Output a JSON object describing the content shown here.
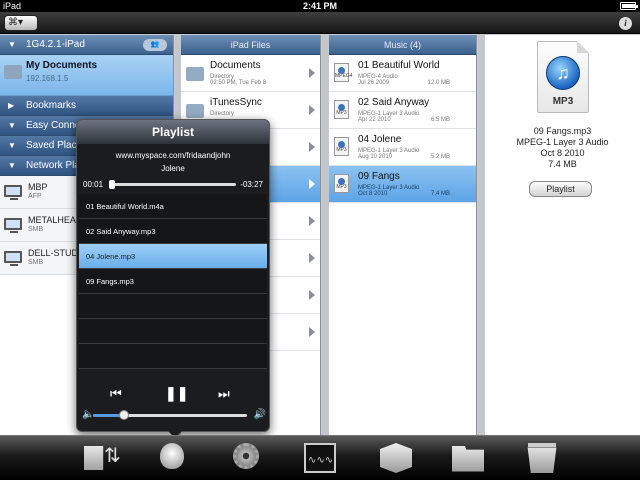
{
  "statusbar": {
    "carrier": "iPad",
    "time": "2:41 PM",
    "battery_level": 0.9
  },
  "toolbar": {
    "menu_glyph": "⌘▾",
    "info_glyph": "i"
  },
  "sidebar": {
    "device_header": "1G4.2.1-iPad",
    "my_documents": {
      "title": "My Documents",
      "subtitle": "192.168.1.5"
    },
    "sections": [
      {
        "label": "Bookmarks"
      },
      {
        "label": "Easy Connect™"
      },
      {
        "label": "Saved Places"
      },
      {
        "label": "Network Places"
      }
    ],
    "devices": [
      {
        "name": "MBP",
        "type": "AFP"
      },
      {
        "name": "METALHEAD",
        "type": "SMB"
      },
      {
        "name": "DELL-STUDIO",
        "type": "SMB"
      }
    ]
  },
  "ipad_files": {
    "header": "iPad Files",
    "rows": [
      {
        "name": "Documents",
        "kind": "Directory",
        "date": "02:50 PM, Tue Feb 8"
      },
      {
        "name": "iTunesSync",
        "kind": "Directory",
        "date": ""
      }
    ]
  },
  "music": {
    "header": "Music (4)",
    "rows": [
      {
        "name": "01 Beautiful World",
        "kind": "MPEG-4 Audio",
        "date": "Jul 26 2009",
        "size": "12.0 MB",
        "icon": "MPEG4"
      },
      {
        "name": "02 Said Anyway",
        "kind": "MPEG-1 Layer 3 Audio",
        "date": "Apr 22 2010",
        "size": "6.5 MB",
        "icon": "MP3"
      },
      {
        "name": "04 Jolene",
        "kind": "MPEG-1 Layer 3 Audio",
        "date": "Aug 10 2010",
        "size": "5.2 MB",
        "icon": "MP3"
      },
      {
        "name": "09 Fangs",
        "kind": "MPEG-1 Layer 3 Audio",
        "date": "Oct 8 2010",
        "size": "7.4 MB",
        "icon": "MP3"
      }
    ]
  },
  "detail": {
    "icon_label": "MP3",
    "icon_glyph": "♫",
    "filename": "09 Fangs.mp3",
    "kind": "MPEG-1 Layer 3 Audio",
    "date": "Oct 8 2010",
    "size": "7.4 MB",
    "button": "Playlist"
  },
  "playlist": {
    "title": "Playlist",
    "source": "www.myspace.com/fridaandjohn",
    "now_playing": "Jolene",
    "elapsed": "00:01",
    "remaining": "-03:27",
    "progress": 0.01,
    "volume": 0.2,
    "items": [
      "01 Beautiful World.m4a",
      "02 Said Anyway.mp3",
      "04 Jolene.mp3",
      "09 Fangs.mp3"
    ],
    "controls": {
      "prev": "⏮",
      "pause": "❚❚",
      "next": "⏭",
      "vol_min": "🔈",
      "vol_max": "🔊"
    }
  },
  "tabbar": {
    "tabs": [
      "transfer-icon",
      "media-player-icon",
      "settings-gear-icon",
      "activity-monitor-icon",
      "package-icon",
      "folder-icon",
      "trash-icon"
    ]
  }
}
